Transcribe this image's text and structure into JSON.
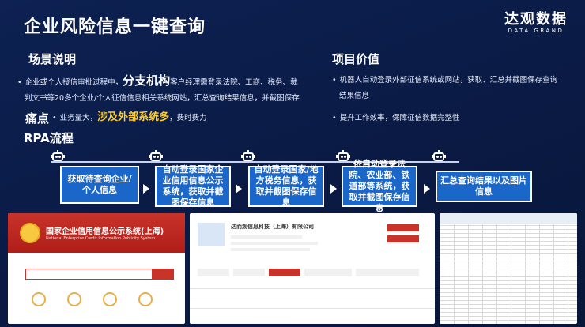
{
  "header": {
    "title": "企业风险信息一键查询"
  },
  "logo": {
    "cn": "达观数据",
    "en": "DATA GRAND"
  },
  "scenario": {
    "heading": "场景说明",
    "line1_pre": "企业或个人授信审批过程中，",
    "line1_highlight": "分支机构",
    "line1_post": "客户经理需登录法院、工商、税务、裁",
    "line2": "判文书等20多个企业/个人征信信息相关系统网站，汇总查询结果信息，并截图保存"
  },
  "pain": {
    "heading": "痛点",
    "pre": "业务量大，",
    "highlight": "涉及外部系统多",
    "post": "，费时费力"
  },
  "value": {
    "heading": "项目价值",
    "line1": "机器人自动登录外部征信系统或网站，获取、汇总并截图保存查询",
    "line2": "结果信息",
    "line3": "提升工作效率，保障征信数据完整性"
  },
  "rpa": {
    "heading": "RPA流程",
    "steps": [
      "获取待查询企业/个人信息",
      "自动登录国家企业信用信息公示系统，获取并截图保存信息",
      "自动登录国家/地方税务信息，获取并截图保存信息",
      "依自动登录法院、农业部、铁道部等系统，获取并截图保存信息",
      "汇总查询结果以及图片信息"
    ]
  },
  "screens": {
    "gsxt_title": "国家企业信用信息公示系统(上海)",
    "gsxt_sub": "National Enterprise Credit Information Publicity System",
    "company_name": "达而观信息科技（上海）有限公司"
  }
}
